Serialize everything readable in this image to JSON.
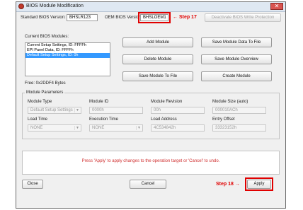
{
  "window": {
    "title": "BIOS Module Modification",
    "close_glyph": "✕"
  },
  "top": {
    "standard_label": "Standard BIOS Version:",
    "standard_value": "BHSLR123",
    "oem_label": "OEM BIOS Version:",
    "oem_value": "BHSLOEM1",
    "step17": "← Step 17",
    "deactivate_button": "Deactivate BIOS Write Protection"
  },
  "modules": {
    "label": "Current BIOS Modules:",
    "items": [
      "Current Setup Settings, ID: FFFFh",
      "EPI Panel Data, ID: FFFFh",
      "Default Setup Settings, ID: 0h"
    ],
    "selected_index": 2,
    "free": "Free: 0x2DDF4 Bytes"
  },
  "actions": {
    "add": "Add Module",
    "save_to_file": "Save Module Data To File",
    "delete": "Delete Module",
    "overview": "Save Module Overview",
    "save_module_file": "Save Module To File",
    "create": "Create Module"
  },
  "params": {
    "legend": "Module Parameters",
    "type_label": "Module Type",
    "type_value": "Default Setup Settings",
    "id_label": "Module ID",
    "id_value": "0000h",
    "revision_label": "Module Revision",
    "revision_value": "00h",
    "size_label": "Module Size (auto)",
    "size_value": "000010ACh",
    "loadtime_label": "Load Time",
    "loadtime_value": "NONE",
    "exectime_label": "Execution Time",
    "exectime_value": "NONE",
    "address_label": "Load Address",
    "address_value": "4C534842h",
    "entry_label": "Entry Offset",
    "entry_value": "33323152h"
  },
  "message": "Press 'Apply' to apply changes to the operation target or 'Cancel' to undo.",
  "footer": {
    "close": "Close",
    "cancel": "Cancel",
    "step18": "Step 18 →",
    "apply": "Apply"
  },
  "colors": {
    "annotation": "#e00000",
    "selection": "#3399ff",
    "message": "#d03030"
  }
}
